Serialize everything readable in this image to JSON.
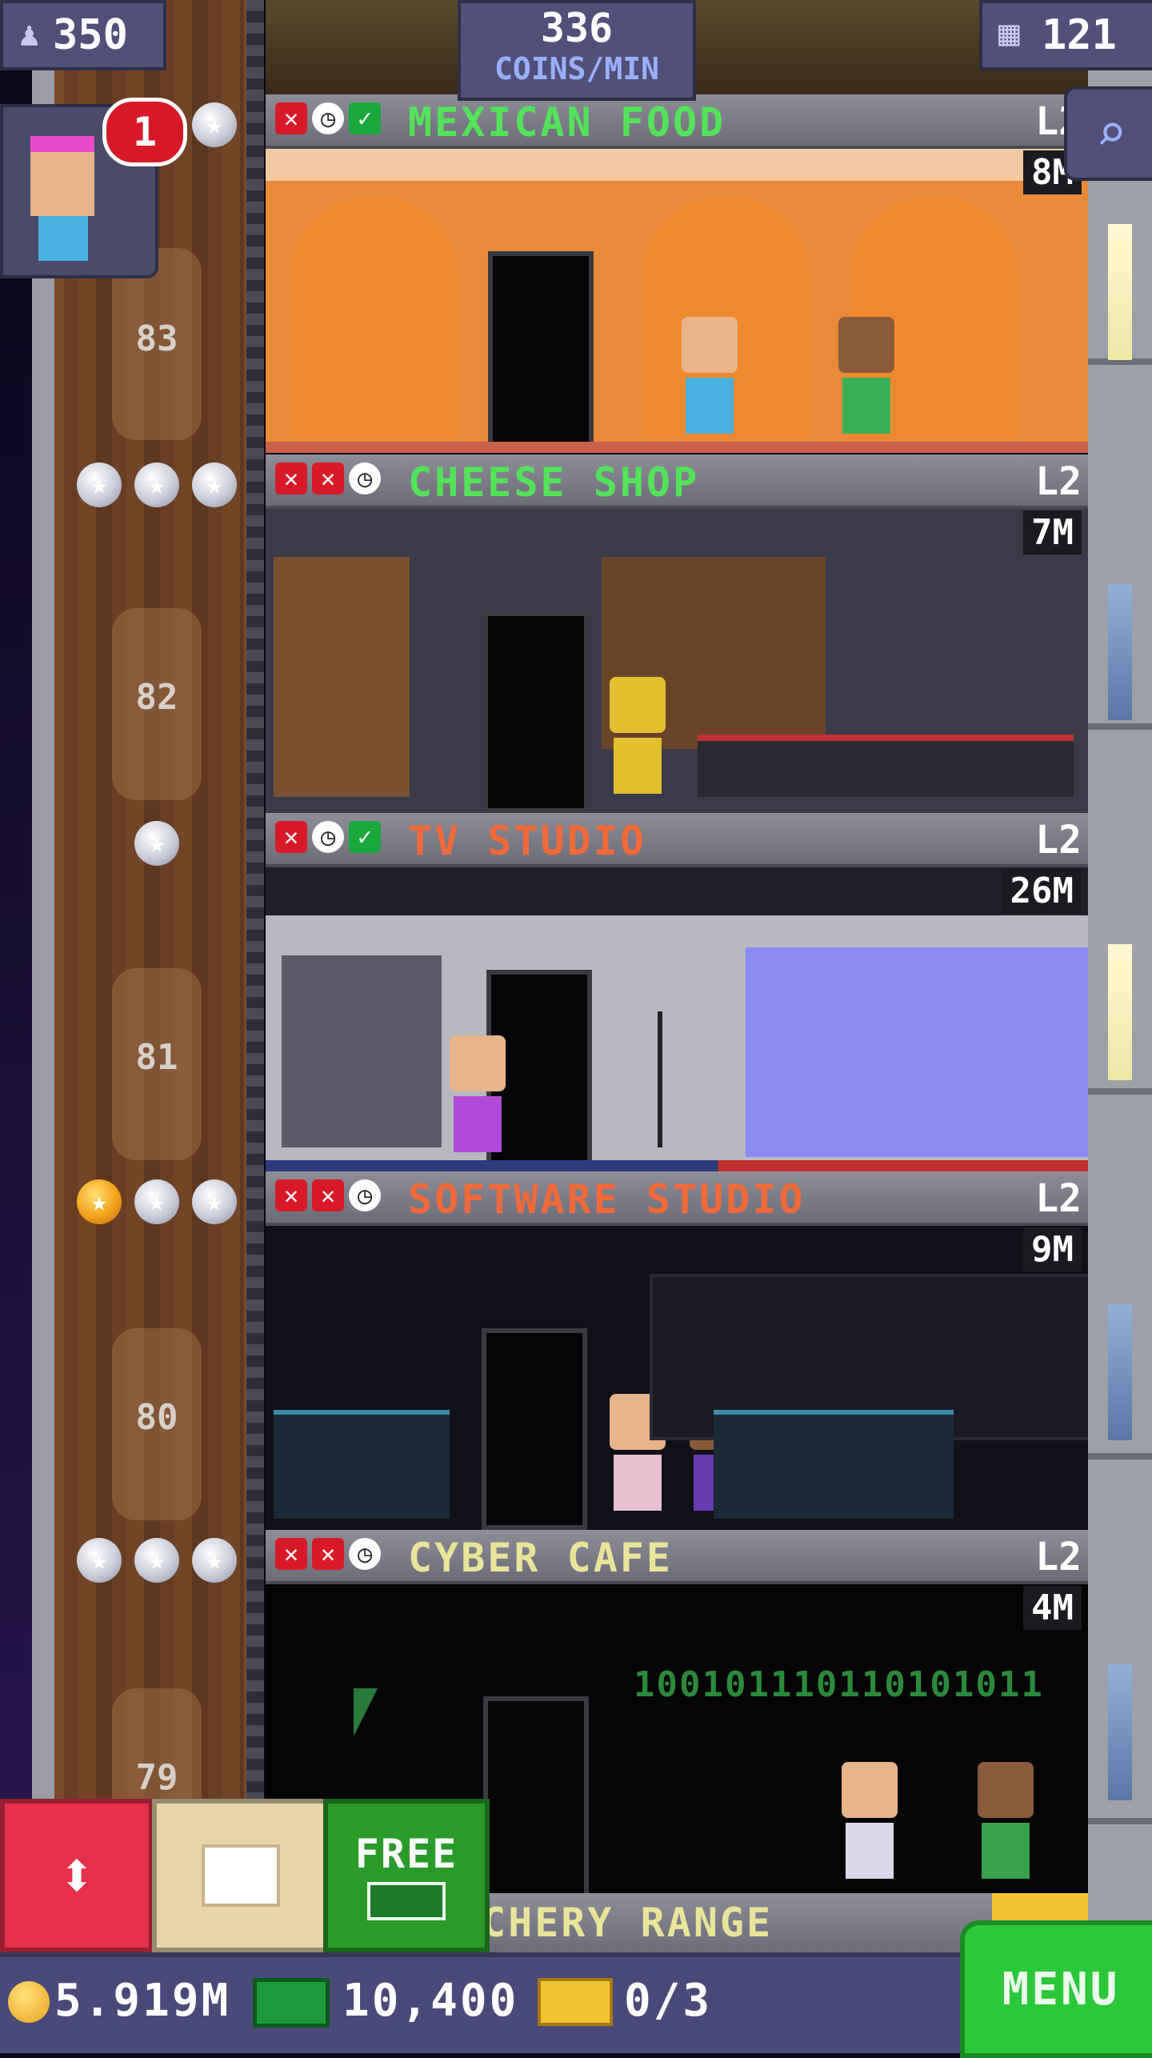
{
  "top_bar": {
    "population": "350",
    "coins_rate_value": "336",
    "coins_rate_unit": "COINS/MIN",
    "floors_count": "121"
  },
  "notification": {
    "badge_count": "1"
  },
  "floors": [
    {
      "number": "83",
      "name": "MEXICAN FOOD",
      "level": "L2",
      "coins": "8M",
      "name_color": "#54e25a",
      "stocks": [
        "x",
        "clock",
        "check"
      ],
      "stars": [
        "silver"
      ]
    },
    {
      "number": "82",
      "name": "CHEESE SHOP",
      "level": "L2",
      "coins": "7M",
      "name_color": "#54e25a",
      "stocks": [
        "x",
        "x",
        "clock"
      ],
      "stars": [
        "silver",
        "silver",
        "silver"
      ]
    },
    {
      "number": "81",
      "name": "TV STUDIO",
      "level": "L2",
      "coins": "26M",
      "name_color": "#f06a3a",
      "stocks": [
        "x",
        "clock",
        "check"
      ],
      "stars": [
        "silver"
      ]
    },
    {
      "number": "80",
      "name": "SOFTWARE STUDIO",
      "level": "L2",
      "coins": "9M",
      "name_color": "#f06a3a",
      "stocks": [
        "x",
        "x",
        "clock"
      ],
      "stars": [
        "gold",
        "silver",
        "silver"
      ]
    },
    {
      "number": "79",
      "name": "CYBER CAFE",
      "level": "L2",
      "coins": "4M",
      "name_color": "#e8e49a",
      "stocks": [
        "x",
        "x",
        "clock"
      ],
      "stars": [
        "silver",
        "silver",
        "silver"
      ]
    }
  ],
  "cyber_cafe_screen_text": "100101110110101011",
  "partial_floor_name": "CHERY RANGE",
  "action_buttons": {
    "free_label": "FREE"
  },
  "bottom_bar": {
    "coins": "5.919M",
    "bux": "10,400",
    "tickets": "0/3",
    "menu_label": "MENU"
  },
  "colors": {
    "mexican_wall": "#e88a3a",
    "cheese_wall": "#3a3a48",
    "tv_backdrop": "#8a8af0",
    "software_wall": "#101018",
    "cyber_code": "#2a8a3a"
  }
}
